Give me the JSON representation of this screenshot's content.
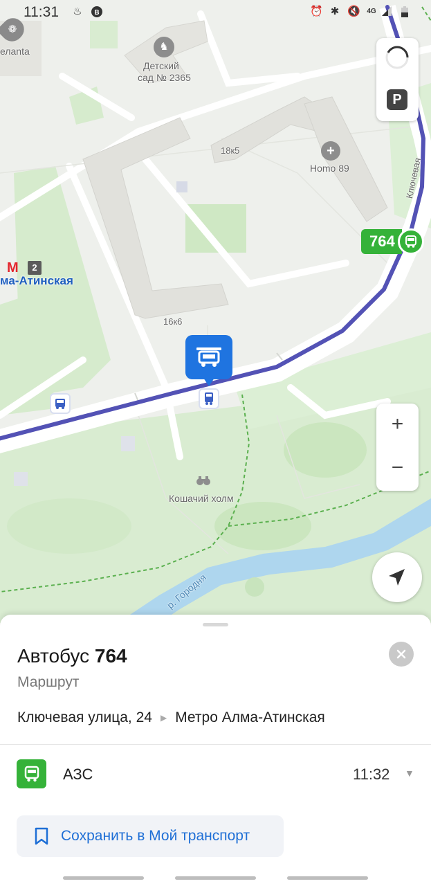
{
  "status_bar": {
    "time": "11:31",
    "icons": [
      "tinder-icon",
      "vk-icon",
      "alarm-icon",
      "bluetooth-icon",
      "mute-icon",
      "4g-signal-icon",
      "signal-icon",
      "battery-icon"
    ]
  },
  "map": {
    "labels": {
      "pet_shop": "елanta",
      "kindergarten_line1": "Детский",
      "kindergarten_line2": "сад № 2365",
      "bldg_18k5": "18к5",
      "homo89": "Homo 89",
      "bldg_16k6": "16к6",
      "street": "Ключевая",
      "metro_station": "ма-Атинская",
      "metro_line": "2",
      "park": "Кошачий холм",
      "river": "р. Городня"
    },
    "route_number": "764",
    "controls": {
      "parking_label": "P",
      "zoom_in": "+",
      "zoom_out": "−"
    },
    "colors": {
      "route": "#5352b5",
      "bus_green": "#35b239",
      "stop_blue": "#1f74e0",
      "river": "#aed6ee",
      "park": "#d8ecd0"
    }
  },
  "sheet": {
    "title_prefix": "Автобус",
    "title_number": "764",
    "subtitle": "Маршрут",
    "route_from": "Ключевая улица, 24",
    "route_to": "Метро Алма-Атинская",
    "stop": {
      "name": "АЗС",
      "time": "11:32"
    },
    "save_label": "Сохранить в Мой транспорт"
  }
}
